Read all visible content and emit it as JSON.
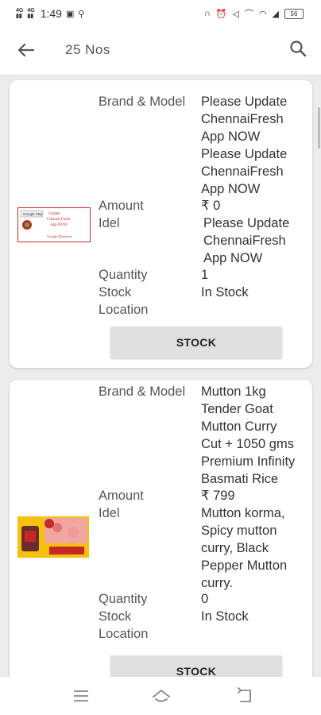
{
  "status": {
    "net1": "4G",
    "net2": "4G",
    "time": "1:49",
    "battery": "56"
  },
  "appbar": {
    "title": "25  Nos"
  },
  "products": [
    {
      "brand_label": "Brand & Model",
      "brand_value": "Please Update ChennaiFresh App NOW Please Update ChennaiFresh App NOW",
      "amount_label": "Amount",
      "amount_value": "₹ 0",
      "idel_label": "Idel",
      "idel_value": "Please Update ChennaiFresh App NOW",
      "quantity_label": "Quantity",
      "quantity_value": "1",
      "stock_label": "Stock",
      "stock_value": "In Stock",
      "location_label": "Location",
      "location_value": "",
      "button_label": "STOCK",
      "thumb_text": {
        "line1": "Update",
        "line2": "Chennai Fresh",
        "line3": "App NOW",
        "store": "Google Play",
        "bottom": "Google PlayStore"
      }
    },
    {
      "brand_label": "Brand & Model",
      "brand_value": "Mutton 1kg Tender Goat Mutton Curry Cut + 1050 gms Premium Infinity Basmati Rice",
      "amount_label": "Amount",
      "amount_value": "₹ 799",
      "idel_label": "Idel",
      "idel_value": "Mutton korma, Spicy mutton curry, Black Pepper Mutton curry.",
      "quantity_label": "Quantity",
      "quantity_value": "0",
      "stock_label": "Stock",
      "stock_value": "In Stock",
      "location_label": "Location",
      "location_value": "",
      "button_label": "STOCK"
    }
  ],
  "colors": {
    "background": "#ececec",
    "card": "#ffffff",
    "button": "#e0e0e0",
    "accent_red": "#c62828",
    "accent_yellow": "#f4c20d"
  }
}
